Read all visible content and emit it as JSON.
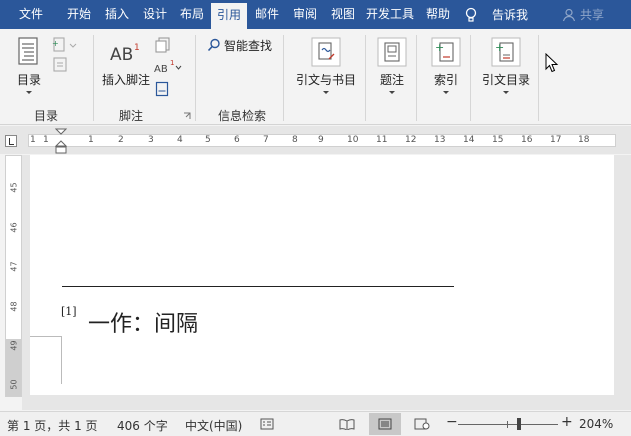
{
  "tabs": [
    {
      "label": "文件",
      "active": false
    },
    {
      "label": "开始",
      "active": false
    },
    {
      "label": "插入",
      "active": false
    },
    {
      "label": "设计",
      "active": false
    },
    {
      "label": "布局",
      "active": false
    },
    {
      "label": "引用",
      "active": true
    },
    {
      "label": "邮件",
      "active": false
    },
    {
      "label": "审阅",
      "active": false
    },
    {
      "label": "视图",
      "active": false
    },
    {
      "label": "开发工具",
      "active": false
    },
    {
      "label": "帮助",
      "active": false
    }
  ],
  "tell_me": "告诉我",
  "share": "共享",
  "ribbon": {
    "toc": {
      "button": "目录",
      "group": "目录"
    },
    "footnotes": {
      "insert_footnote": "插入脚注",
      "group": "脚注"
    },
    "research": {
      "smart_lookup": "智能查找",
      "group": "信息检索"
    },
    "citations": {
      "button": "引文与书目"
    },
    "captions": {
      "button": "题注"
    },
    "index": {
      "button": "索引"
    },
    "toa": {
      "button": "引文目录"
    }
  },
  "ruler": {
    "h_numbers": [
      "1",
      "1",
      "1",
      "2",
      "3",
      "4",
      "5",
      "6",
      "7",
      "8",
      "9",
      "10",
      "11",
      "12",
      "13",
      "14",
      "15",
      "16",
      "17",
      "18"
    ],
    "v_numbers": [
      "45",
      "46",
      "47",
      "48",
      "49",
      "50"
    ]
  },
  "document": {
    "footnote_mark": "[1]",
    "footnote_text": "一作：间隔"
  },
  "status": {
    "page": "第 1 页，共 1 页",
    "words": "406 个字",
    "language": "中文(中国)",
    "zoom": "204%"
  }
}
